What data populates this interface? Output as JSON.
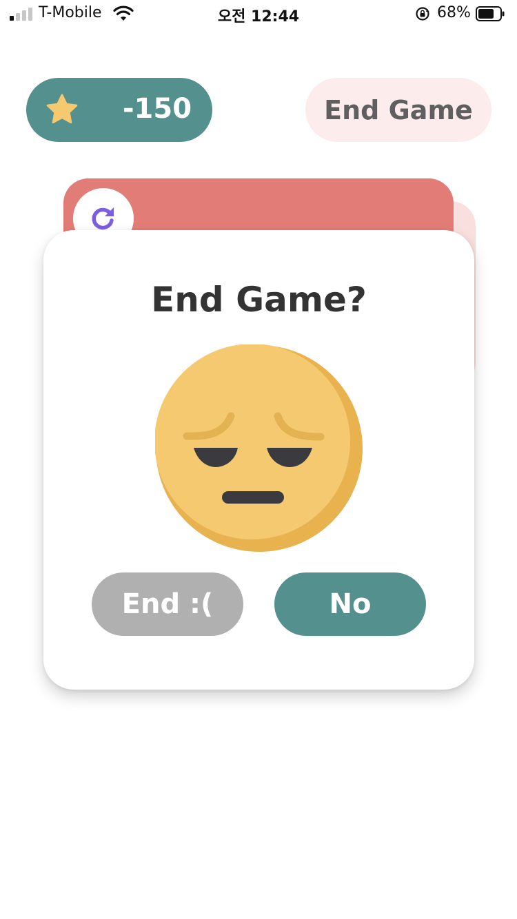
{
  "status_bar": {
    "carrier": "T-Mobile",
    "time": "오전 12:44",
    "battery_percent": "68%",
    "icons": [
      "signal-icon",
      "wifi-icon",
      "rotation-lock-icon",
      "battery-icon"
    ]
  },
  "header": {
    "score": "-150",
    "score_icon": "star-icon",
    "end_game_label": "End Game"
  },
  "card": {
    "refresh_icon": "refresh-icon"
  },
  "dialog": {
    "title": "End Game?",
    "face_icon": "sad-face-icon",
    "end_label": "End :(",
    "no_label": "No"
  },
  "colors": {
    "teal": "#54908e",
    "end_game_bg": "#fcecec",
    "card_red": "#e27c76",
    "card_pink": "#f9dfdd",
    "end_button_grey": "#b0b0b0",
    "face_yellow": "#f5c970",
    "refresh_purple": "#7b5fe0"
  }
}
